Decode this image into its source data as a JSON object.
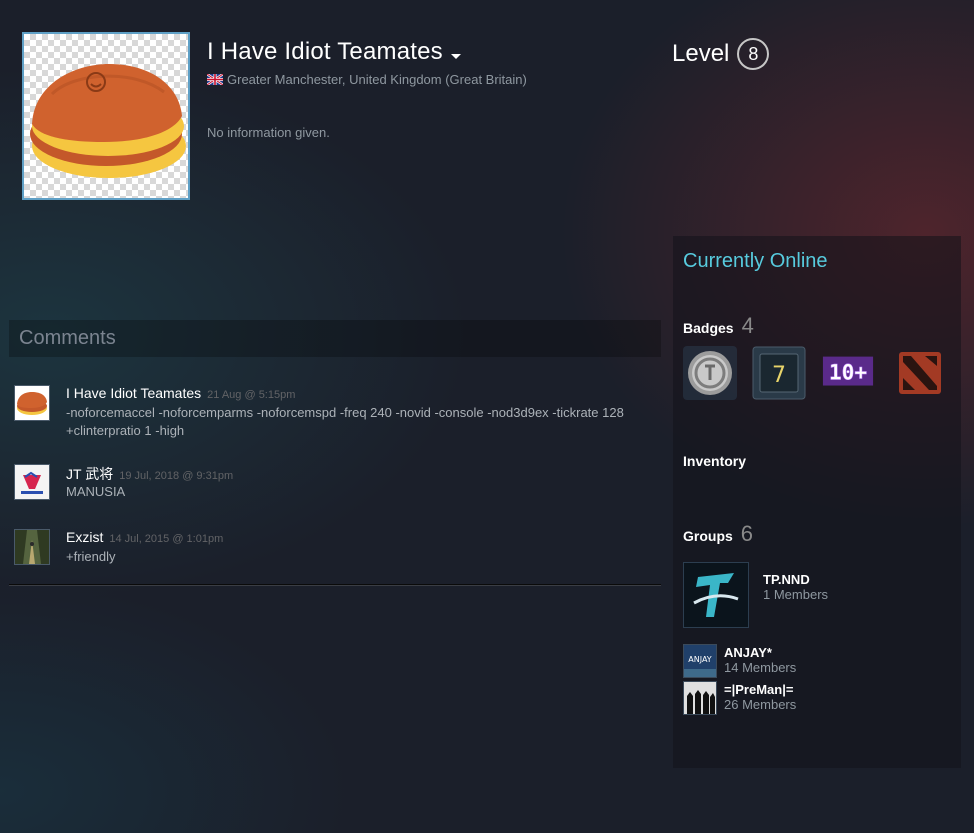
{
  "profile": {
    "persona_name": "I Have Idiot Teamates",
    "location": "Greater Manchester, United Kingdom (Great Britain)",
    "summary": "No information given.",
    "level_label": "Level",
    "level": "8",
    "flag_icon": "uk-flag-icon",
    "avatar_icon": "dorayaki-avatar-icon"
  },
  "comments": {
    "header": "Comments",
    "items": [
      {
        "author": "I Have Idiot Teamates",
        "date": "21 Aug @ 5:15pm",
        "text": "-noforcemaccel -noforcemparms -noforcemspd -freq 240 -novid -console -nod3d9ex -tickrate 128 +clinterpratio 1 -high"
      },
      {
        "author": "JT 武将",
        "date": "19 Jul, 2018 @ 9:31pm",
        "text": "MANUSIA"
      },
      {
        "author": "Exzist",
        "date": "14 Jul, 2015 @ 1:01pm",
        "text": "+friendly"
      }
    ]
  },
  "sidebar": {
    "status": "Currently Online",
    "badges": {
      "label": "Badges",
      "count": "4",
      "icons": [
        "coin-badge-icon",
        "years-of-service-badge-icon",
        "ten-plus-badge-icon",
        "dota2-badge-icon"
      ],
      "badge_7_text": "7",
      "badge_10_text": "10+"
    },
    "inventory": {
      "label": "Inventory"
    },
    "groups": {
      "label": "Groups",
      "count": "6",
      "items": [
        {
          "name": "TP.NND",
          "members": "1 Members"
        },
        {
          "name": "ANJAY*",
          "members": "14 Members"
        },
        {
          "name": "=|PreMan|=",
          "members": "26 Members"
        }
      ],
      "anjay_icon_text": "ANJAY"
    }
  },
  "colors": {
    "accent_online": "#57cbde",
    "avatar_border": "#5fa0c6",
    "background": "#1b1f2a"
  }
}
